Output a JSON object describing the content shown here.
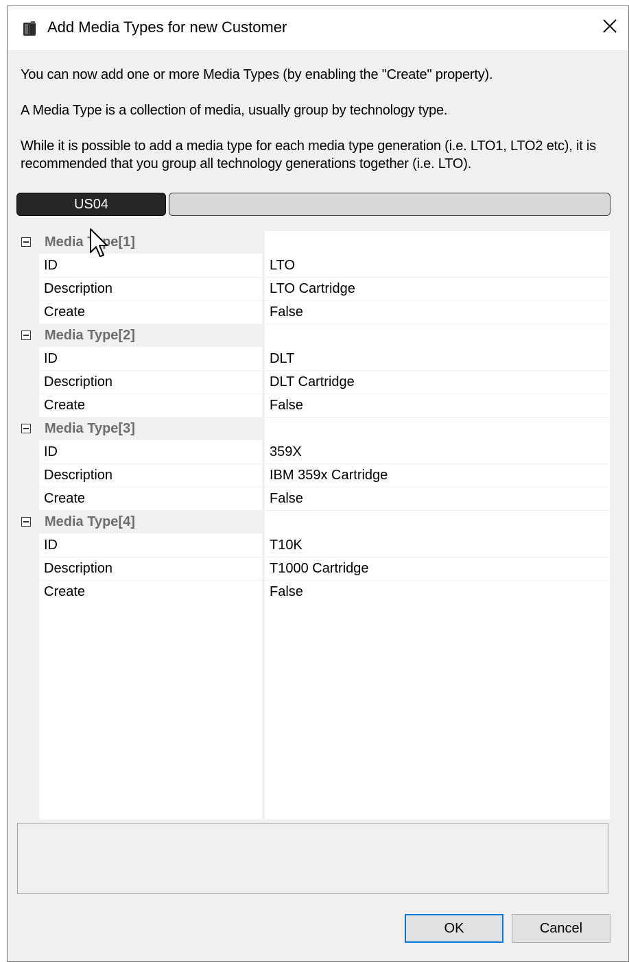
{
  "window": {
    "title": "Add Media Types for new Customer",
    "icon": "tape-icon",
    "close_icon": "close-icon"
  },
  "intro": {
    "line1": "You can now add one or more Media Types (by enabling the \"Create\" property).",
    "line2": "A Media Type is a collection of media, usually group by technology type.",
    "line3": "While it is possible to add a media type for each media type generation (i.e. LTO1, LTO2 etc), it is recommended that you group all technology generations together (i.e. LTO)."
  },
  "tabs": {
    "active_label": "US04"
  },
  "media_types": [
    {
      "label": "Media Type[1]",
      "id_label": "ID",
      "id": "LTO",
      "description_label": "Description",
      "description": "LTO Cartridge",
      "create_label": "Create",
      "create": "False"
    },
    {
      "label": "Media Type[2]",
      "id_label": "ID",
      "id": "DLT",
      "description_label": "Description",
      "description": "DLT Cartridge",
      "create_label": "Create",
      "create": "False"
    },
    {
      "label": "Media Type[3]",
      "id_label": "ID",
      "id": "359X",
      "description_label": "Description",
      "description": "IBM 359x Cartridge",
      "create_label": "Create",
      "create": "False"
    },
    {
      "label": "Media Type[4]",
      "id_label": "ID",
      "id": "T10K",
      "description_label": "Description",
      "description": "T1000 Cartridge",
      "create_label": "Create",
      "create": "False"
    }
  ],
  "buttons": {
    "ok": "OK",
    "cancel": "Cancel"
  },
  "colors": {
    "accent": "#0078d7",
    "tab_active_bg": "#262626",
    "category_text": "#6d6d6d"
  }
}
